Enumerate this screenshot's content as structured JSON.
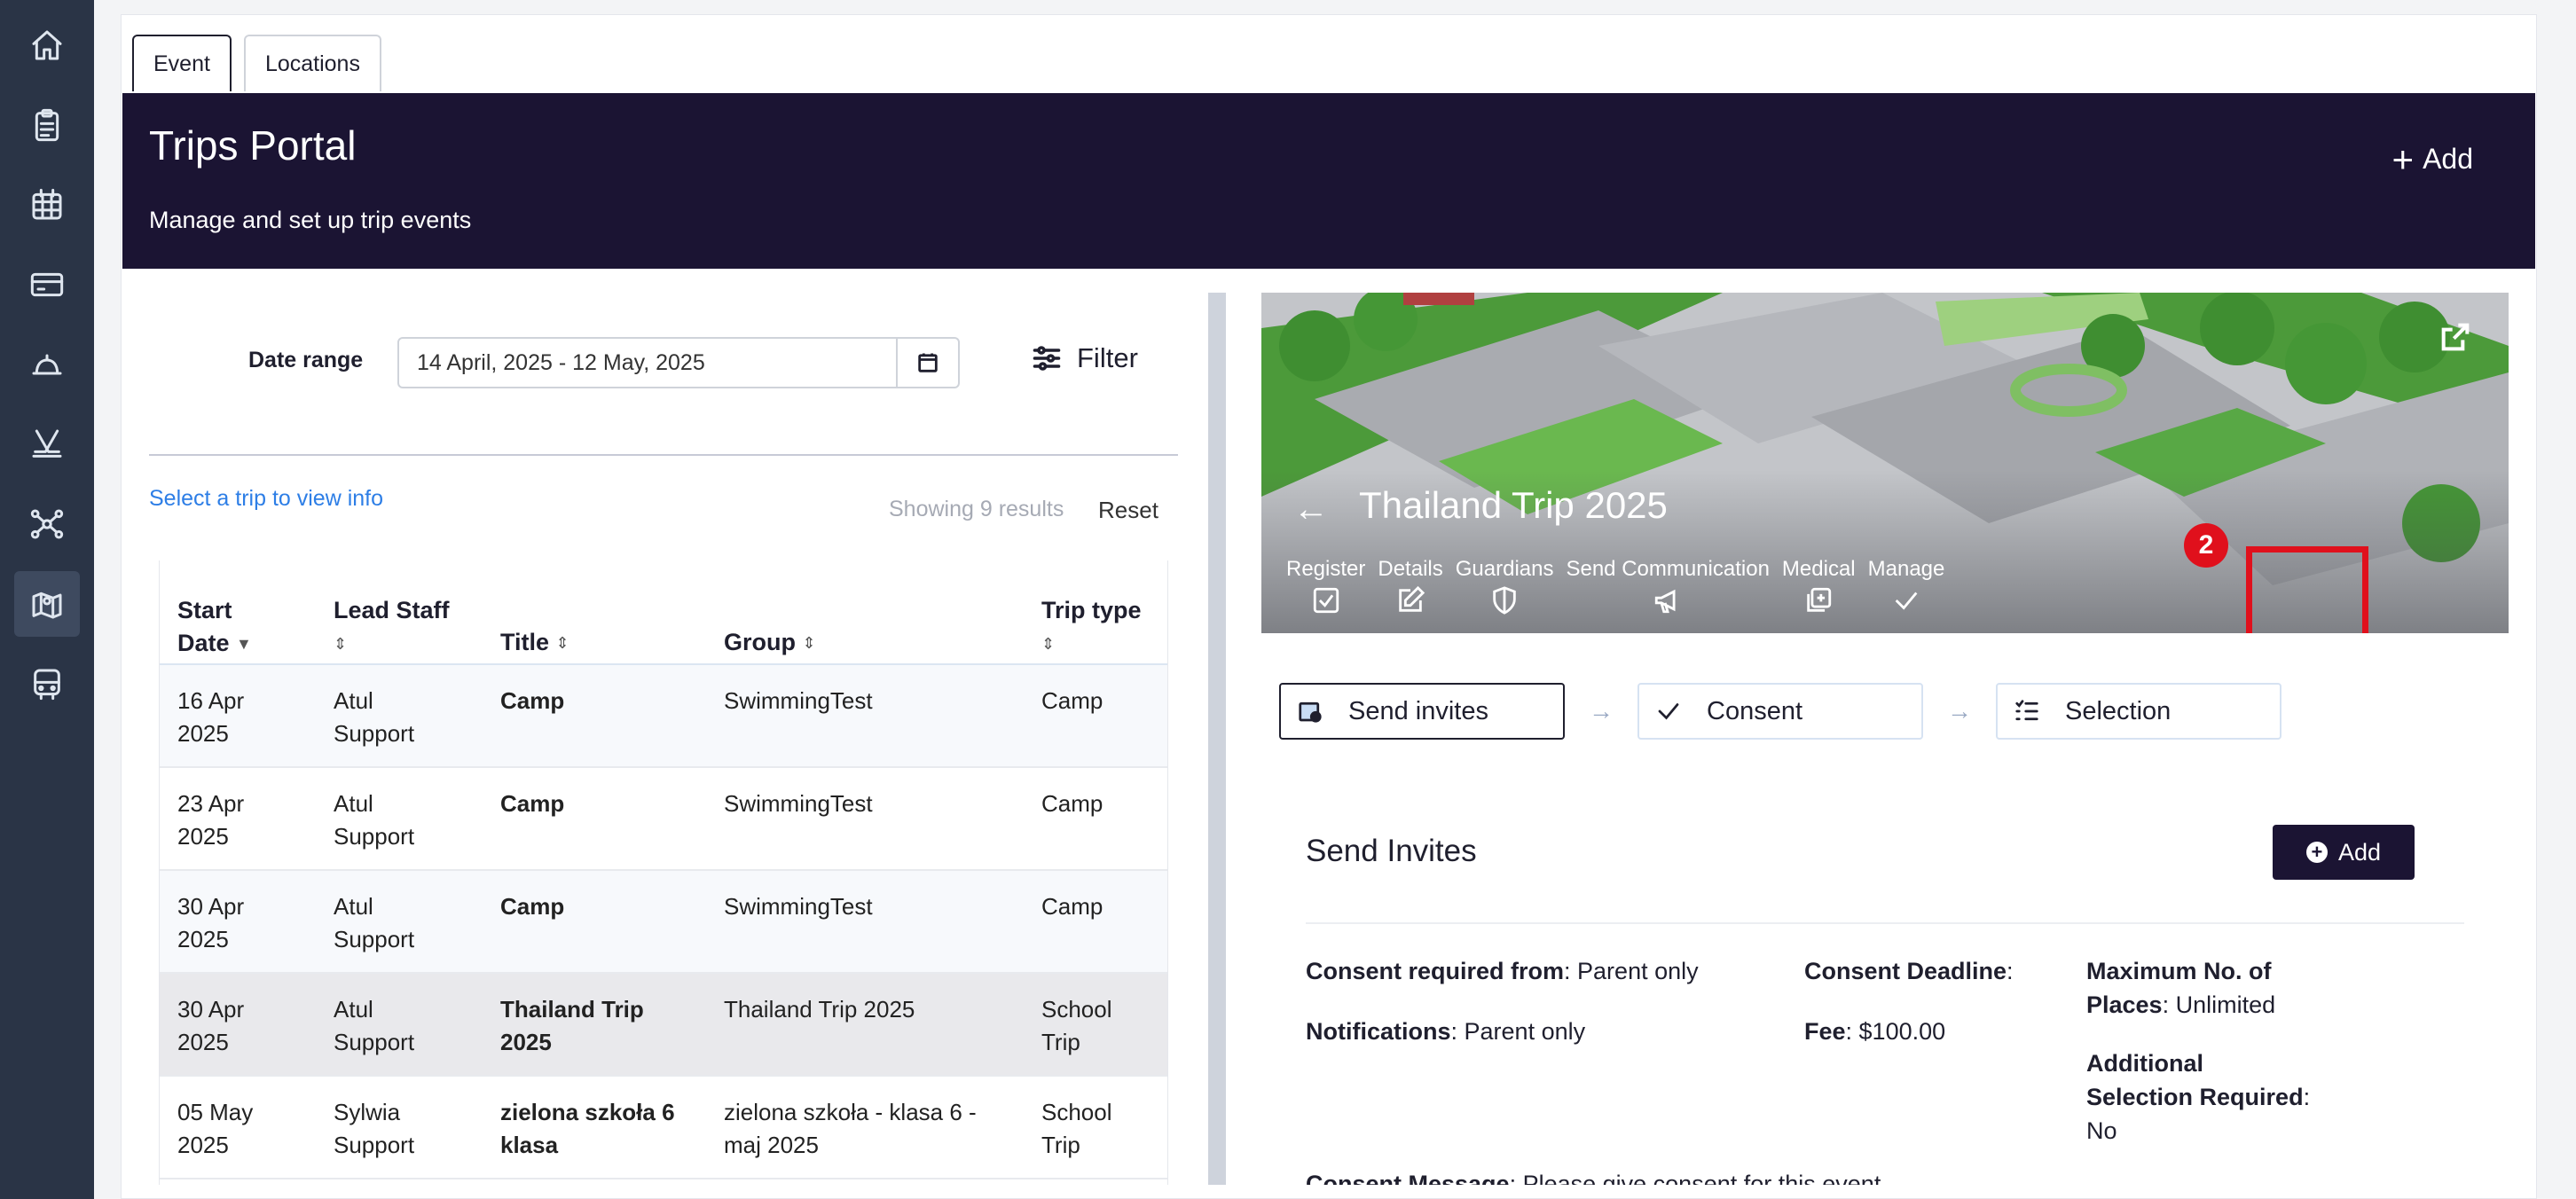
{
  "sidebar": {
    "items": [
      {
        "icon": "home-icon"
      },
      {
        "icon": "clipboard-icon"
      },
      {
        "icon": "calendar-grid-icon"
      },
      {
        "icon": "card-icon"
      },
      {
        "icon": "bell-icon"
      },
      {
        "icon": "hockey-icon"
      },
      {
        "icon": "network-icon"
      },
      {
        "icon": "map-pin-icon",
        "active": true
      },
      {
        "icon": "bus-icon"
      }
    ]
  },
  "tabs": [
    "Event",
    "Locations"
  ],
  "banner": {
    "title": "Trips Portal",
    "subtitle": "Manage and set up trip events",
    "add_label": "Add"
  },
  "filters": {
    "date_label": "Date range",
    "date_value": "14 April, 2025 - 12 May, 2025",
    "filter_label": "Filter",
    "select_hint": "Select a trip to view info",
    "showing": "Showing 9 results",
    "reset": "Reset"
  },
  "table": {
    "headers": {
      "start_date_1": "Start",
      "start_date_2": "Date",
      "lead_staff": "Lead Staff",
      "title": "Title",
      "group": "Group",
      "trip_type": "Trip type"
    },
    "rows": [
      {
        "date1": "16 Apr",
        "date2": "2025",
        "staff1": "Atul",
        "staff2": "Support",
        "title1": "Camp",
        "title2": "",
        "group1": "SwimmingTest",
        "group2": "",
        "type1": "Camp",
        "type2": ""
      },
      {
        "date1": "23 Apr",
        "date2": "2025",
        "staff1": "Atul",
        "staff2": "Support",
        "title1": "Camp",
        "title2": "",
        "group1": "SwimmingTest",
        "group2": "",
        "type1": "Camp",
        "type2": ""
      },
      {
        "date1": "30 Apr",
        "date2": "2025",
        "staff1": "Atul",
        "staff2": "Support",
        "title1": "Camp",
        "title2": "",
        "group1": "SwimmingTest",
        "group2": "",
        "type1": "Camp",
        "type2": ""
      },
      {
        "date1": "30 Apr",
        "date2": "2025",
        "staff1": "Atul",
        "staff2": "Support",
        "title1": "Thailand Trip",
        "title2": "2025",
        "group1": "Thailand Trip 2025",
        "group2": "",
        "type1": "School",
        "type2": "Trip"
      },
      {
        "date1": "05 May",
        "date2": "2025",
        "staff1": "Sylwia",
        "staff2": "Support",
        "title1": "zielona szkoła 6",
        "title2": "klasa",
        "group1": "zielona szkoła - klasa 6 -",
        "group2": "maj 2025",
        "type1": "School",
        "type2": "Trip"
      }
    ]
  },
  "trip": {
    "title": "Thailand Trip 2025",
    "nav": [
      "Register",
      "Details",
      "Guardians",
      "Send Communication",
      "Medical",
      "Manage"
    ],
    "badge": "2",
    "steps": [
      "Send invites",
      "Consent",
      "Selection"
    ],
    "section_title": "Send Invites",
    "add_label": "Add",
    "consent_required_label": "Consent required from",
    "consent_required_value": ": Parent only",
    "notifications_label": "Notifications",
    "notifications_value": ": Parent only",
    "deadline_label": "Consent Deadline",
    "deadline_value": ":",
    "fee_label": "Fee",
    "fee_value": ": $100.00",
    "max_places_label_1": "Maximum No. of",
    "max_places_label_2": "Places",
    "max_places_value": ": Unlimited",
    "additional_label_1": "Additional",
    "additional_label_2": "Selection Required",
    "additional_colon": ":",
    "additional_value": "No",
    "consent_message_label": "Consent Message",
    "consent_message_value": ": Please give consent for this event"
  },
  "colors": {
    "sidebar": "#2a3446",
    "banner": "#1b1433",
    "link": "#2d7ee6",
    "highlight": "#e0101c"
  }
}
